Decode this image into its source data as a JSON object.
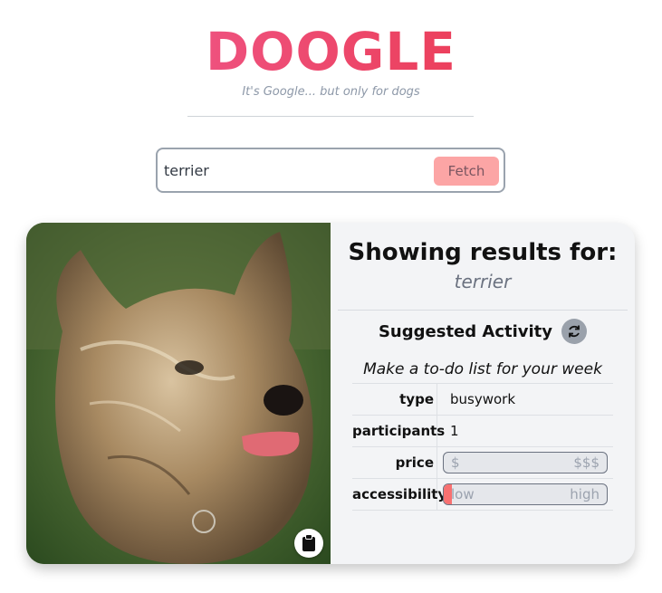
{
  "brand": {
    "title": "DOOGLE",
    "tagline": "It's Google... but only for dogs"
  },
  "search": {
    "value": "terrier",
    "button_label": "Fetch"
  },
  "results": {
    "heading": "Showing results for:",
    "query": "terrier"
  },
  "activity": {
    "heading": "Suggested Activity",
    "description": "Make a to-do list for your week",
    "rows": [
      {
        "key": "type",
        "value": "busywork"
      },
      {
        "key": "participants",
        "value": "1"
      },
      {
        "key": "price",
        "low_label": "$",
        "high_label": "$$$",
        "level": 0
      },
      {
        "key": "accessibility",
        "low_label": "low",
        "high_label": "high",
        "level": 0.05
      }
    ]
  },
  "colors": {
    "logo_start": "#f0609a",
    "logo_end": "#ea3140",
    "fetch_button": "#fca5a5",
    "range_fill": "#f87171"
  },
  "icons": {
    "copy": "clipboard-icon",
    "refresh": "refresh-icon"
  }
}
